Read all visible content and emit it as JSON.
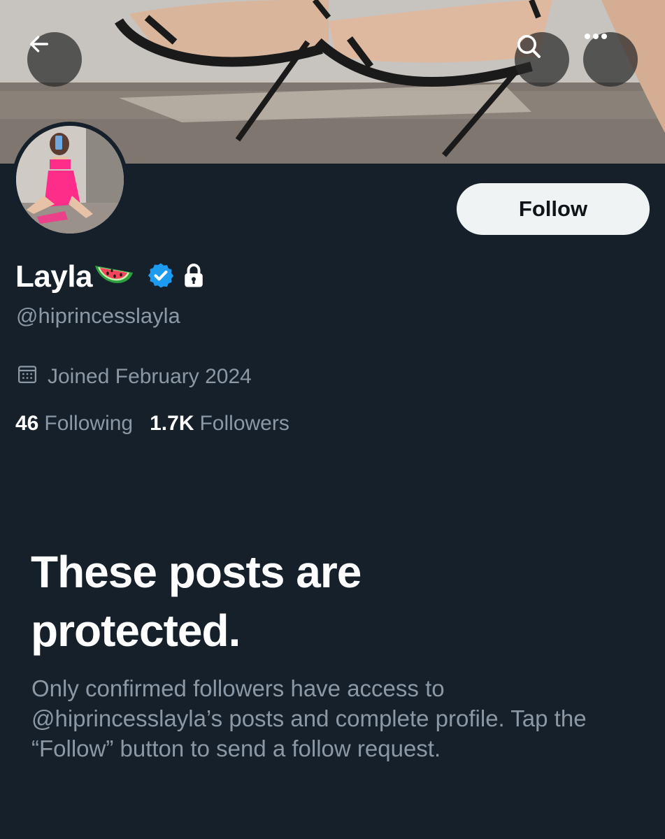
{
  "profile": {
    "display_name": "Layla",
    "handle": "@hiprincesslayla",
    "joined": "Joined February 2024",
    "following_count": "46",
    "following_label": "Following",
    "followers_count": "1.7K",
    "followers_label": "Followers"
  },
  "actions": {
    "follow_label": "Follow"
  },
  "protected": {
    "title": "These posts are protected.",
    "body": "Only confirmed followers have access to @hiprincesslayla’s posts and complete profile. Tap the “Follow” button to send a follow request."
  },
  "icons": {
    "back": "back-arrow-icon",
    "search": "search-icon",
    "more": "more-options-icon",
    "verified": "verified-badge-icon",
    "lock": "lock-icon",
    "calendar": "calendar-icon",
    "emoji": "watermelon-icon"
  },
  "colors": {
    "background": "#15202b",
    "secondary_text": "#8b98a5",
    "verified_blue": "#1d9bf0",
    "follow_button_bg": "#eff3f4"
  }
}
